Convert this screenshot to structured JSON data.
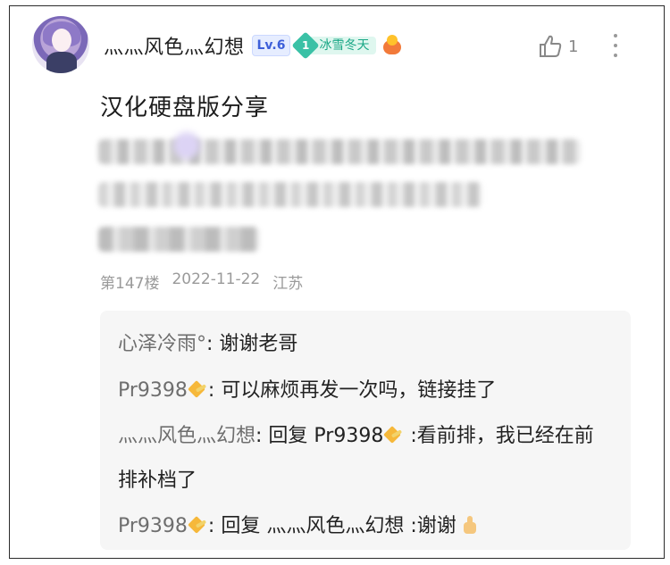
{
  "comment": {
    "username": "灬灬风色灬幻想",
    "level": "Lv.6",
    "fan_badge": {
      "level": "1",
      "name": "冰雪冬天"
    },
    "icons": {
      "avatar": "user-avatar",
      "medal": "medal-icon",
      "like": "thumb-up-icon",
      "more": "more-vertical-icon"
    },
    "like_count": "1",
    "title": "汉化硬盘版分享",
    "floor": "第147楼",
    "date": "2022-11-22",
    "location": "江苏"
  },
  "replies": [
    {
      "author": "心泽冷雨°",
      "sep": ": ",
      "text": "谢谢老哥"
    },
    {
      "author": "Pr9398",
      "sep": ": ",
      "text": "可以麻烦再发一次吗，链接挂了"
    },
    {
      "author": "灬灬风色灬幻想",
      "sep": ": ",
      "reply_word": "回复 ",
      "target": "Pr9398",
      "text": " :看前排，我已经在前排补档了"
    },
    {
      "author": "Pr9398",
      "sep": ": ",
      "reply_word": "回复 ",
      "target": "灬灬风色灬幻想",
      "text": " :谢谢"
    }
  ],
  "colors": {
    "level_badge": "#3d5fd9",
    "fan_badge": "#1aa786",
    "meta": "#9a9a9a",
    "reply_bg": "#f6f6f6"
  }
}
